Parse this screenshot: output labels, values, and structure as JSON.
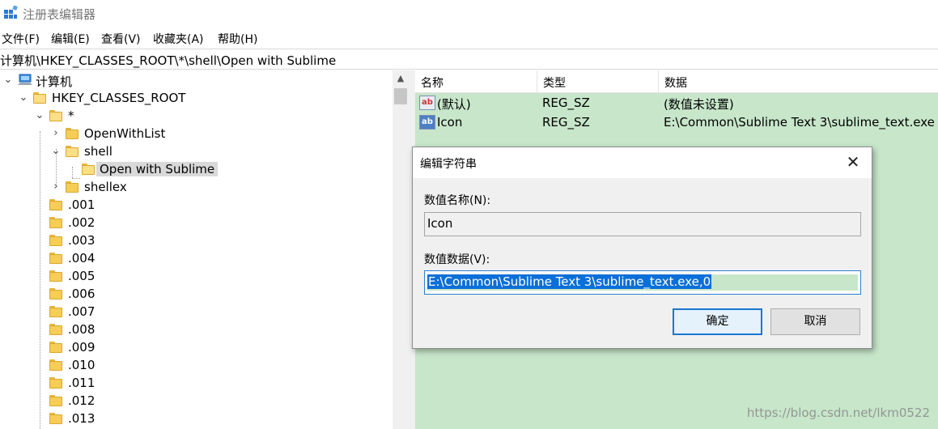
{
  "window": {
    "title": "注册表编辑器"
  },
  "menu": [
    "文件(F)",
    "编辑(E)",
    "查看(V)",
    "收藏夹(A)",
    "帮助(H)"
  ],
  "address": "计算机\\HKEY_CLASSES_ROOT\\*\\shell\\Open with Sublime",
  "tree": {
    "computer": "计算机",
    "hkcr": "HKEY_CLASSES_ROOT",
    "star": "*",
    "openwithlist": "OpenWithList",
    "shell": "shell",
    "open_with_sublime": "Open with Sublime",
    "shellex": "shellex",
    "extensions": [
      ".001",
      ".002",
      ".003",
      ".004",
      ".005",
      ".006",
      ".007",
      ".008",
      ".009",
      ".010",
      ".011",
      ".012",
      ".013"
    ]
  },
  "values": {
    "headers": {
      "name": "名称",
      "type": "类型",
      "data": "数据"
    },
    "rows": [
      {
        "name": "(默认)",
        "type": "REG_SZ",
        "data": "(数值未设置)"
      },
      {
        "name": "Icon",
        "type": "REG_SZ",
        "data": "E:\\Common\\Sublime Text 3\\sublime_text.exe"
      }
    ]
  },
  "dialog": {
    "title": "编辑字符串",
    "name_label": "数值名称(N):",
    "name_value": "Icon",
    "data_label": "数值数据(V):",
    "data_value": "E:\\Common\\Sublime Text 3\\sublime_text.exe,0",
    "ok": "确定",
    "cancel": "取消"
  },
  "watermark": "https://blog.csdn.net/lkm0522",
  "colors": {
    "values_bg": "#c7e6ca",
    "selection": "#0a6fd8",
    "folder": "#f5cd57"
  }
}
